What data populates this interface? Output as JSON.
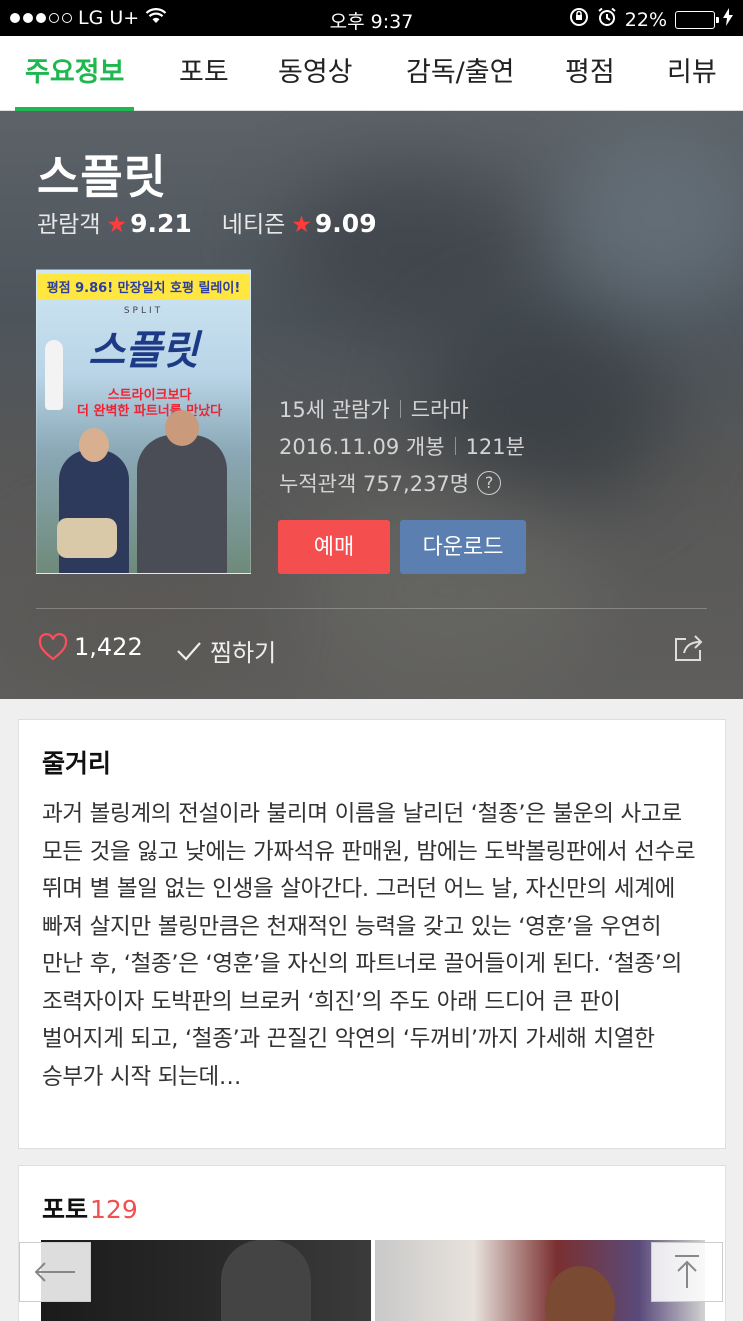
{
  "status_bar": {
    "carrier": "LG U+",
    "time": "오후 9:37",
    "battery": "22%",
    "battery_level": 0.22
  },
  "tabs": [
    {
      "label": "주요정보",
      "active": true
    },
    {
      "label": "포토",
      "active": false
    },
    {
      "label": "동영상",
      "active": false
    },
    {
      "label": "감독/출연",
      "active": false
    },
    {
      "label": "평점",
      "active": false
    },
    {
      "label": "리뷰",
      "active": false
    }
  ],
  "movie": {
    "title": "스플릿",
    "audience_label": "관람객",
    "audience_score": "9.21",
    "netizen_label": "네티즌",
    "netizen_score": "9.09",
    "rating": "15세 관람가",
    "genre": "드라마",
    "release": "2016.11.09 개봉",
    "runtime": "121분",
    "cumulative": "누적관객 757,237명",
    "help_icon": "?"
  },
  "poster": {
    "banner": "평점 9.86! 만장일치 호평 릴레이!",
    "subtitle": "SPLIT",
    "title": "스플릿",
    "tagline_1": "스트라이크보다",
    "tagline_2": "더 완벽한 파트너를 만났다"
  },
  "buttons": {
    "reserve": "예매",
    "download": "다운로드"
  },
  "actions": {
    "likes": "1,422",
    "wish": "찜하기"
  },
  "story": {
    "heading": "줄거리",
    "text": "과거 볼링계의 전설이라 불리며 이름을 날리던 ‘철종’은 불운의 사고로 모든 것을 잃고 낮에는 가짜석유 판매원, 밤에는 도박볼링판에서 선수로 뛰며 별 볼일 없는 인생을 살아간다. 그러던 어느 날, 자신만의 세계에 빠져 살지만 볼링만큼은 천재적인 능력을 갖고 있는 ‘영훈’을 우연히 만난 후, ‘철종’은 ‘영훈’을 자신의 파트너로 끌어들이게 된다. ‘철종’의 조력자이자 도박판의 브로커 ‘희진’의 주도 아래 드디어 큰 판이 벌어지게 되고, ‘철종’과 끈질긴 악연의 ‘두꺼비’까지 가세해 치열한 승부가 시작 되는데…"
  },
  "photos": {
    "heading": "포토",
    "count": "129"
  },
  "colors": {
    "accent_green": "#1fb750",
    "reserve_red": "#f54e4e",
    "download_blue": "#5b7fb0",
    "star_red": "#ff3b3b",
    "count_red": "#f25050"
  }
}
